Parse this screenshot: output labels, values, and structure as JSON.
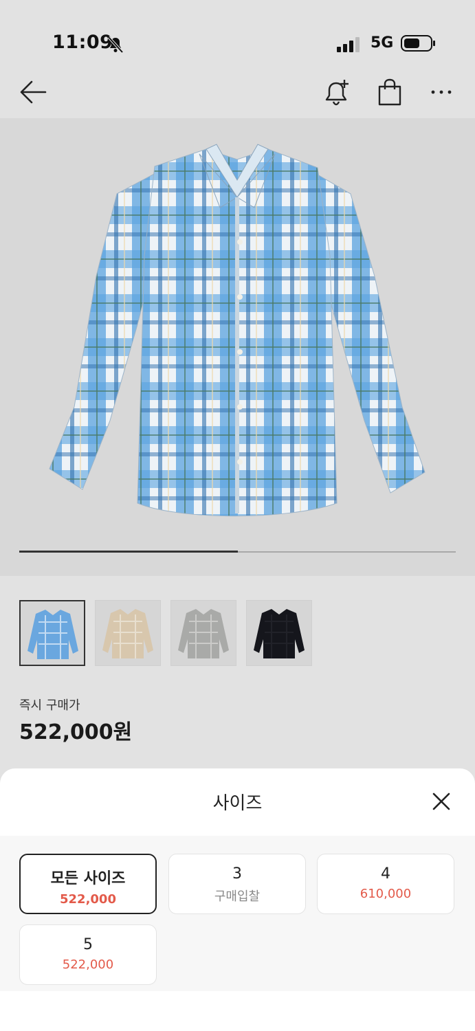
{
  "status": {
    "time": "11:09",
    "network": "5G"
  },
  "nav": {
    "icons": [
      "back-arrow-icon",
      "bell-plus-icon",
      "shopping-bag-icon",
      "more-icon"
    ]
  },
  "gallery": {
    "progress": 0.5,
    "thumbnails": [
      {
        "color": "#6aa7df",
        "accent": "#ffffff",
        "selected": true
      },
      {
        "color": "#d8c7ad",
        "accent": "#f4efe6",
        "selected": false
      },
      {
        "color": "#a9aaa8",
        "accent": "#e2e2df",
        "selected": false
      },
      {
        "color": "#15161c",
        "accent": "#2a2b33",
        "selected": false
      }
    ]
  },
  "price": {
    "label": "즉시 구매가",
    "value": "522,000원"
  },
  "sheet": {
    "title": "사이즈",
    "options": [
      {
        "name": "모든 사이즈",
        "price": "522,000",
        "selected": true
      },
      {
        "name": "3",
        "price": "구매입찰",
        "muted": true
      },
      {
        "name": "4",
        "price": "610,000"
      },
      {
        "name": "5",
        "price": "522,000"
      }
    ]
  },
  "colors": {
    "accent_red": "#e35a4a",
    "sheet_bg": "#ffffff",
    "page_bg": "#e2e2e2"
  }
}
